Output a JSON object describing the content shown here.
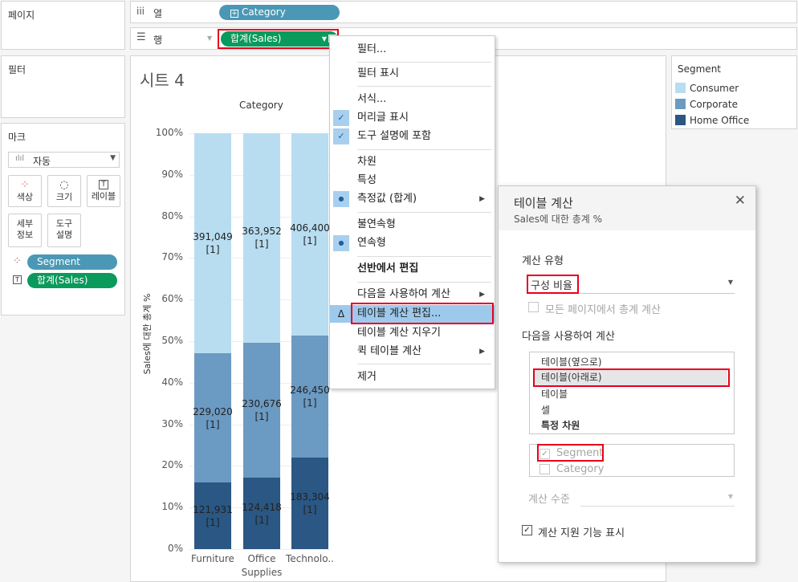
{
  "left_panel": {
    "pages_title": "페이지",
    "filters_title": "필터",
    "marks_title": "마크",
    "mark_type": "자동",
    "buttons": [
      {
        "icon": "color-dots-icon",
        "label": "색상"
      },
      {
        "icon": "size-icon",
        "label": "크기"
      },
      {
        "icon": "label-icon",
        "label": "레이블"
      },
      {
        "icon": "detail-icon",
        "label_lines": [
          "세부",
          "정보"
        ]
      },
      {
        "icon": "tooltip-icon",
        "label_lines": [
          "도구",
          "설명"
        ]
      }
    ],
    "mark_pills": [
      "Segment",
      "합계(Sales)"
    ]
  },
  "shelves": {
    "columns_label": "열",
    "columns_pill": "Category",
    "rows_label": "행",
    "rows_pill": "합계(Sales)"
  },
  "sheet": {
    "title": "시트 4",
    "category_header": "Category",
    "ylabel": "Sales에 대한 총계 %"
  },
  "chart_data": {
    "type": "bar",
    "stacked": true,
    "categories": [
      "Furniture",
      "Office Supplies",
      "Technology"
    ],
    "category_display": [
      "Furniture",
      "Office",
      "Technolo.."
    ],
    "category_display_line2": [
      "",
      "Supplies",
      ""
    ],
    "series": [
      {
        "name": "Home Office",
        "color": "#2a5783",
        "values": [
          16.0,
          17.1,
          22.0
        ],
        "labels": [
          "121,931",
          "124,418",
          "183,304"
        ]
      },
      {
        "name": "Corporate",
        "color": "#6b9ac3",
        "values": [
          31.1,
          32.6,
          29.4
        ],
        "labels": [
          "229,020",
          "230,676",
          "246,450"
        ]
      },
      {
        "name": "Consumer",
        "color": "#b8ddf0",
        "values": [
          52.9,
          50.3,
          48.6
        ],
        "labels": [
          "391,049",
          "363,952",
          "406,400"
        ]
      }
    ],
    "label_suffix": "[1]",
    "yticks": [
      "100%",
      "90%",
      "80%",
      "70%",
      "60%",
      "50%",
      "40%",
      "30%",
      "20%",
      "10%",
      "0%"
    ],
    "ylim": [
      0,
      100
    ]
  },
  "legend": {
    "title": "Segment",
    "items": [
      {
        "label": "Consumer",
        "color": "#b8ddf0"
      },
      {
        "label": "Corporate",
        "color": "#6b9ac3"
      },
      {
        "label": "Home Office",
        "color": "#2a5783"
      }
    ]
  },
  "context_menu": {
    "items": [
      {
        "label": "필터...",
        "lead": "",
        "arrow": false
      },
      {
        "label": "필터 표시",
        "lead": "",
        "arrow": false
      },
      {
        "label": "서식...",
        "lead": "",
        "arrow": false
      },
      {
        "label": "머리글 표시",
        "lead": "✓",
        "arrow": false
      },
      {
        "label": "도구 설명에 포함",
        "lead": "✓",
        "arrow": false
      },
      {
        "label": "차원",
        "lead": "",
        "arrow": false
      },
      {
        "label": "특성",
        "lead": "",
        "arrow": false
      },
      {
        "label": "측정값 (합계)",
        "lead": "●",
        "arrow": true
      },
      {
        "label": "불연속형",
        "lead": "",
        "arrow": false
      },
      {
        "label": "연속형",
        "lead": "●",
        "arrow": false
      },
      {
        "label": "선반에서 편집",
        "lead": "",
        "arrow": false
      },
      {
        "label": "다음을 사용하여 계산",
        "lead": "",
        "arrow": true
      },
      {
        "label": "테이블 계산 편집...",
        "lead": "Δ",
        "arrow": false
      },
      {
        "label": "테이블 계산 지우기",
        "lead": "",
        "arrow": false
      },
      {
        "label": "퀵 테이블 계산",
        "lead": "",
        "arrow": true
      },
      {
        "label": "제거",
        "lead": "",
        "arrow": false
      }
    ]
  },
  "table_calc_dialog": {
    "title": "테이블 계산",
    "subtitle": "Sales에 대한 총계 %",
    "calc_type_label": "계산 유형",
    "calc_type_value": "구성 비율",
    "all_pages_label": "모든 페이지에서 총계 계산",
    "compute_using_label": "다음을 사용하여 계산",
    "compute_options": [
      "테이블(옆으로)",
      "테이블(아래로)",
      "테이블",
      "셀",
      "특정 차원"
    ],
    "dimensions": [
      "Segment",
      "Category"
    ],
    "level_label": "계산 수준",
    "show_assist_label": "계산 지원 기능 표시"
  }
}
